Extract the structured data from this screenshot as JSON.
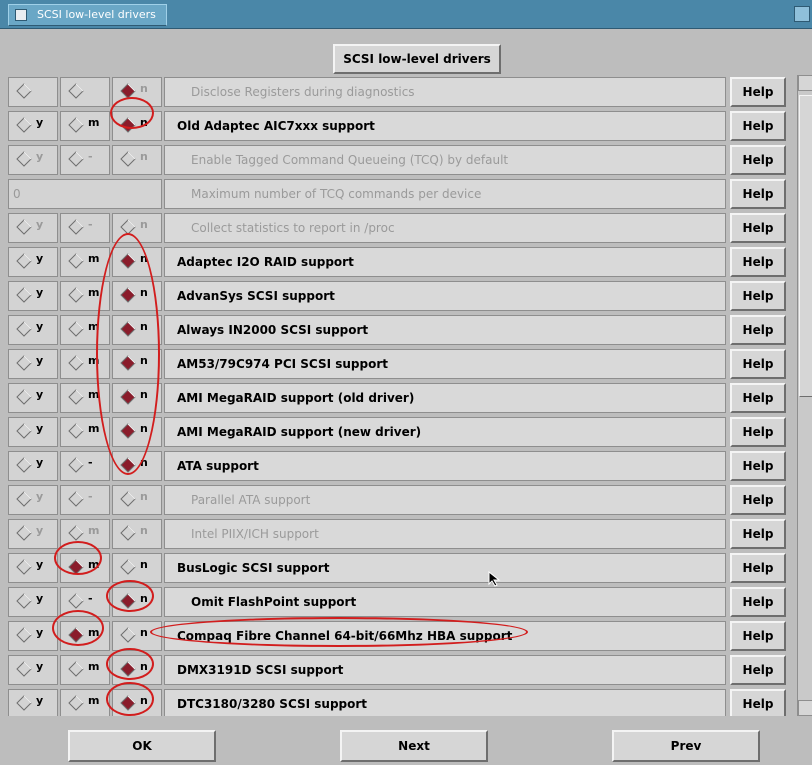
{
  "window": {
    "title": "SCSI low-level drivers"
  },
  "header": {
    "button_label": "SCSI low-level drivers"
  },
  "rows": [
    {
      "type": "opt",
      "y": "",
      "m": "",
      "n": "n",
      "label": "Disclose Registers during diagnostics",
      "disabled": true,
      "sub": true,
      "sel": "n"
    },
    {
      "type": "opt",
      "y": "y",
      "m": "m",
      "n": "n",
      "label": "Old Adaptec AIC7xxx support",
      "disabled": false,
      "sub": false,
      "sel": "n"
    },
    {
      "type": "opt",
      "y": "y",
      "m": "-",
      "n": "n",
      "label": "Enable Tagged Command Queueing (TCQ) by default",
      "disabled": true,
      "sub": true,
      "sel": ""
    },
    {
      "type": "num",
      "value": "0",
      "label": "Maximum number of TCQ commands per device",
      "disabled": true,
      "sub": true
    },
    {
      "type": "opt",
      "y": "y",
      "m": "-",
      "n": "n",
      "label": "Collect statistics to report in /proc",
      "disabled": true,
      "sub": true,
      "sel": ""
    },
    {
      "type": "opt",
      "y": "y",
      "m": "m",
      "n": "n",
      "label": "Adaptec I2O RAID support",
      "disabled": false,
      "sub": false,
      "sel": "n"
    },
    {
      "type": "opt",
      "y": "y",
      "m": "m",
      "n": "n",
      "label": "AdvanSys SCSI support",
      "disabled": false,
      "sub": false,
      "sel": "n"
    },
    {
      "type": "opt",
      "y": "y",
      "m": "m",
      "n": "n",
      "label": "Always IN2000 SCSI support",
      "disabled": false,
      "sub": false,
      "sel": "n"
    },
    {
      "type": "opt",
      "y": "y",
      "m": "m",
      "n": "n",
      "label": "AM53/79C974 PCI SCSI support",
      "disabled": false,
      "sub": false,
      "sel": "n"
    },
    {
      "type": "opt",
      "y": "y",
      "m": "m",
      "n": "n",
      "label": "AMI MegaRAID support (old driver)",
      "disabled": false,
      "sub": false,
      "sel": "n"
    },
    {
      "type": "opt",
      "y": "y",
      "m": "m",
      "n": "n",
      "label": "AMI MegaRAID support (new driver)",
      "disabled": false,
      "sub": false,
      "sel": "n"
    },
    {
      "type": "opt",
      "y": "y",
      "m": "-",
      "n": "n",
      "label": "ATA support",
      "disabled": false,
      "sub": false,
      "sel": "n"
    },
    {
      "type": "opt",
      "y": "y",
      "m": "-",
      "n": "n",
      "label": "Parallel ATA support",
      "disabled": true,
      "sub": true,
      "sel": ""
    },
    {
      "type": "opt",
      "y": "y",
      "m": "m",
      "n": "n",
      "label": "Intel PIIX/ICH support",
      "disabled": true,
      "sub": true,
      "sel": ""
    },
    {
      "type": "opt",
      "y": "y",
      "m": "m",
      "n": "n",
      "label": "BusLogic SCSI support",
      "disabled": false,
      "sub": false,
      "sel": "m"
    },
    {
      "type": "opt",
      "y": "y",
      "m": "-",
      "n": "n",
      "label": "Omit FlashPoint support",
      "disabled": false,
      "sub": true,
      "sel": "n"
    },
    {
      "type": "opt",
      "y": "y",
      "m": "m",
      "n": "n",
      "label": "Compaq Fibre Channel 64-bit/66Mhz HBA support",
      "disabled": false,
      "sub": false,
      "sel": "m"
    },
    {
      "type": "opt",
      "y": "y",
      "m": "m",
      "n": "n",
      "label": "DMX3191D SCSI support",
      "disabled": false,
      "sub": false,
      "sel": "n"
    },
    {
      "type": "opt",
      "y": "y",
      "m": "m",
      "n": "n",
      "label": "DTC3180/3280 SCSI support",
      "disabled": false,
      "sub": false,
      "sel": "n"
    }
  ],
  "help_label": "Help",
  "footer": {
    "ok_label": "OK",
    "next_label": "Next",
    "prev_label": "Prev"
  }
}
